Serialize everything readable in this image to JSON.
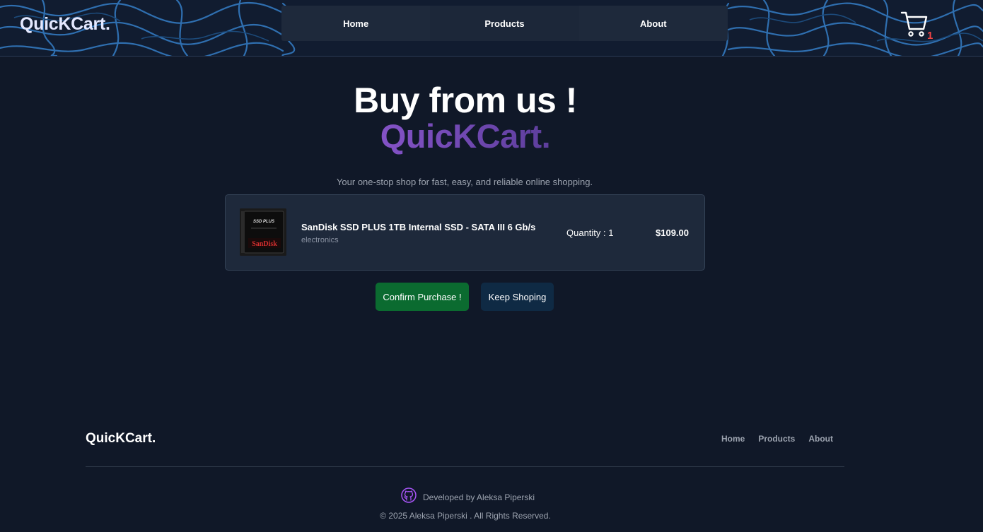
{
  "header": {
    "brand": "QuicKCart",
    "brand_dot": ".",
    "nav": [
      "Home",
      "Products",
      "About"
    ],
    "cart_icon": "shopping-cart-icon",
    "cart_count": "1",
    "cart_count_color": "#ef4444"
  },
  "hero": {
    "title": "Buy from us !",
    "brand": "QuicKCart.",
    "tagline": "Your one-stop shop for fast, easy, and reliable online shopping."
  },
  "cart_items": [
    {
      "name": "SanDisk SSD PLUS 1TB Internal SSD - SATA III 6 Gb/s",
      "category": "electronics",
      "quantity": "Quantity : 1",
      "price": "$109.00",
      "image_icon": "ssd-product-image",
      "image_text_top": "SSD PLUS",
      "image_text_brand": "SanDisk"
    }
  ],
  "actions": {
    "confirm": "Confirm Purchase !",
    "keep": "Keep Shoping",
    "confirm_color": "#0b6b30",
    "keep_color": "#0f2a44"
  },
  "footer": {
    "brand": "QuicKCart.",
    "links": [
      "Home",
      "Products",
      "About"
    ],
    "developer_icon": "github-icon",
    "developer": "Developed by Aleksa Piperski",
    "copyright": "© 2025 Aleksa Piperski . All Rights Reserved."
  }
}
